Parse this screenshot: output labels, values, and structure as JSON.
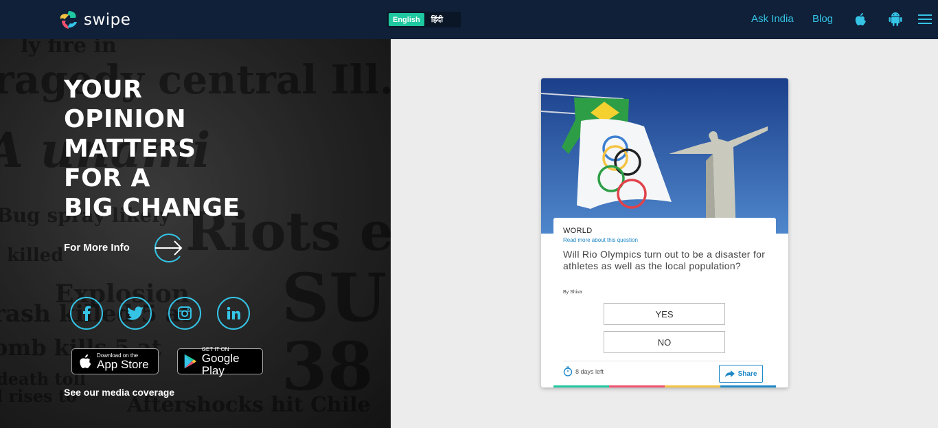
{
  "header": {
    "logo_text": "swipe",
    "languages": [
      {
        "label": "English",
        "active": true
      },
      {
        "label": "हिंदी",
        "active": false
      }
    ],
    "nav_links": [
      "Ask India",
      "Blog"
    ],
    "icons": [
      "apple-icon",
      "android-icon",
      "hamburger-menu-icon"
    ],
    "accent": "#35c3e6",
    "background": "#0f2038"
  },
  "hero": {
    "title_lines": [
      "YOUR",
      "OPINION",
      "MATTERS",
      "FOR A",
      "BIG CHANGE"
    ],
    "more_info": "For More Info",
    "social": [
      "facebook-icon",
      "twitter-icon",
      "instagram-icon",
      "linkedin-icon"
    ],
    "app_store": {
      "small": "Download on the",
      "big": "App Store"
    },
    "google_play": {
      "small": "GET IT ON",
      "big": "Google Play"
    },
    "media_link": "See our media coverage"
  },
  "card": {
    "category": "WORLD",
    "read_more": "Read more about this question",
    "question": "Will Rio Olympics turn out to be a disaster for athletes as well as the local population?",
    "author": "By Shiva",
    "options": [
      "YES",
      "NO"
    ],
    "time_left": "8 days left",
    "share": "Share",
    "bar_colors": [
      "#1ec8a0",
      "#f0506e",
      "#f5c342",
      "#1e88c7"
    ]
  }
}
